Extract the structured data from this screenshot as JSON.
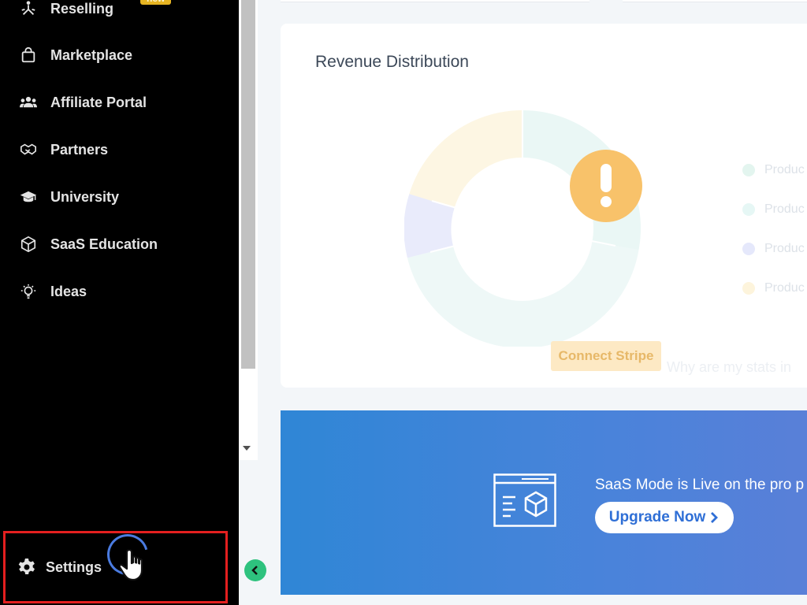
{
  "sidebar": {
    "items": [
      {
        "label": "Reselling",
        "icon": "reselling-icon",
        "badge": "new"
      },
      {
        "label": "Marketplace",
        "icon": "shopping-bag-icon"
      },
      {
        "label": "Affiliate Portal",
        "icon": "users-icon"
      },
      {
        "label": "Partners",
        "icon": "handshake-icon"
      },
      {
        "label": "University",
        "icon": "graduation-cap-icon"
      },
      {
        "label": "SaaS Education",
        "icon": "cube-icon"
      },
      {
        "label": "Ideas",
        "icon": "lightbulb-icon"
      }
    ],
    "settings_label": "Settings"
  },
  "revenue": {
    "title": "Revenue Distribution",
    "connect_label": "Connect Stripe",
    "help_text": "Why are my stats in",
    "legend": [
      "Produc",
      "Produc",
      "Produc",
      "Produc"
    ]
  },
  "banner": {
    "text": "SaaS Mode is Live on the pro p",
    "button_label": "Upgrade Now"
  },
  "colors": {
    "sidebar_bg": "#000000",
    "highlight_border": "#e41f1f",
    "warning": "#f8c26a",
    "collapse_button": "#2ec27e",
    "banner_start": "#2f86d6",
    "banner_end": "#5b7fd8"
  }
}
